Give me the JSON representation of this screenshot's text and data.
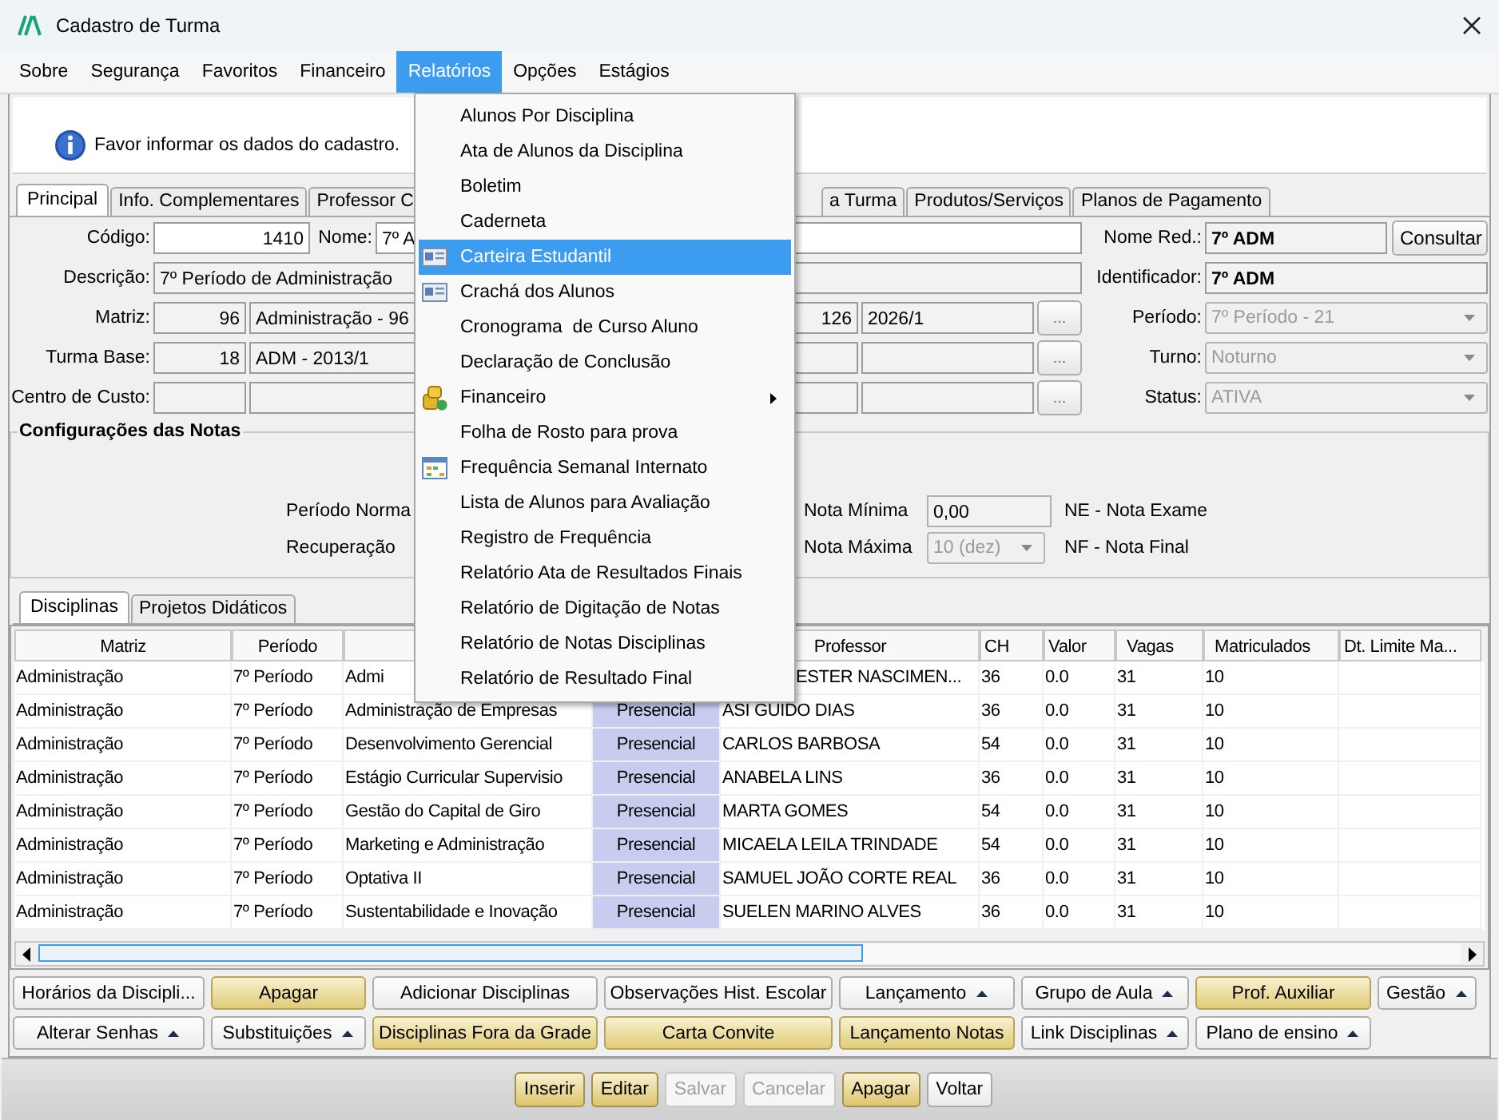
{
  "window": {
    "title": "Cadastro de Turma"
  },
  "menubar": [
    {
      "label": "Sobre",
      "selected": false
    },
    {
      "label": "Segurança",
      "selected": false
    },
    {
      "label": "Favoritos",
      "selected": false
    },
    {
      "label": "Financeiro",
      "selected": false
    },
    {
      "label": "Relatórios",
      "selected": true
    },
    {
      "label": "Opções",
      "selected": false
    },
    {
      "label": "Estágios",
      "selected": false
    }
  ],
  "menu": [
    {
      "label": "Alunos Por Disciplina",
      "selected": false,
      "kind": "plain"
    },
    {
      "label": "Ata de Alunos da Disciplina",
      "selected": false,
      "kind": "plain"
    },
    {
      "label": "Boletim",
      "selected": false,
      "kind": "plain"
    },
    {
      "label": "Caderneta",
      "selected": false,
      "kind": "plain"
    },
    {
      "label": "Carteira Estudantil",
      "selected": true,
      "kind": "card"
    },
    {
      "label": "Crachá dos Alunos",
      "selected": false,
      "kind": "card"
    },
    {
      "label": "Cronograma  de Curso Aluno",
      "selected": false,
      "kind": "plain"
    },
    {
      "label": "Declaração de Conclusão",
      "selected": false,
      "kind": "plain"
    },
    {
      "label": "Financeiro",
      "selected": false,
      "kind": "coins",
      "submenu": true
    },
    {
      "label": "Folha de Rosto para prova",
      "selected": false,
      "kind": "plain"
    },
    {
      "label": "Frequência Semanal Internato",
      "selected": false,
      "kind": "calendar"
    },
    {
      "label": "Lista de Alunos para Avaliação",
      "selected": false,
      "kind": "plain"
    },
    {
      "label": "Registro de Frequência",
      "selected": false,
      "kind": "plain"
    },
    {
      "label": "Relatório Ata de Resultados Finais",
      "selected": false,
      "kind": "plain"
    },
    {
      "label": "Relatório de Digitação de Notas",
      "selected": false,
      "kind": "plain"
    },
    {
      "label": "Relatório de Notas Disciplinas",
      "selected": false,
      "kind": "plain"
    },
    {
      "label": "Relatório de Resultado Final",
      "selected": false,
      "kind": "plain"
    }
  ],
  "info": "Favor informar os dados do cadastro.",
  "tabs": [
    {
      "label": "Principal",
      "selected": true
    },
    {
      "label": "Info. Complementares",
      "selected": false
    },
    {
      "label": "Professor C",
      "selected": false
    },
    {
      "label": "a Turma",
      "selected": false
    },
    {
      "label": "Produtos/Serviços",
      "selected": false
    },
    {
      "label": "Planos de Pagamento",
      "selected": false
    }
  ],
  "form": {
    "codigo": {
      "label": "Código:",
      "value": "1410"
    },
    "nome": {
      "label": "Nome:",
      "value": "7º A"
    },
    "nome_red": {
      "label": "Nome Red.:",
      "value": "7º ADM"
    },
    "consultar": "Consultar",
    "descricao": {
      "label": "Descrição:",
      "value": "7º Período de Administração"
    },
    "identificador": {
      "label": "Identificador:",
      "value": "7º ADM"
    },
    "matriz": {
      "label": "Matriz:",
      "code": "96",
      "name": "Administração - 96",
      "code_2": "126",
      "value_2": "2026/1",
      "browse": "..."
    },
    "turma_base": {
      "label": "Turma Base:",
      "code": "18",
      "name": "ADM - 2013/1",
      "browse": "..."
    },
    "centro_custo": {
      "label": "Centro de Custo:",
      "browse": "..."
    },
    "periodo": {
      "label": "Período:",
      "value": "7º Período - 21",
      "disabled": true
    },
    "turno": {
      "label": "Turno:",
      "value": "Noturno",
      "disabled": true
    },
    "status": {
      "label": "Status:",
      "value": "ATIVA",
      "disabled": true
    }
  },
  "notas": {
    "title": "Configurações das Notas",
    "periodo_normal": "Período Norma",
    "recuperacao": "Recuperação",
    "nota_minima": {
      "label": "Nota Mínima",
      "value": "0,00"
    },
    "nota_maxima": {
      "label": "Nota Máxima",
      "value": "10 (dez)",
      "disabled": true
    },
    "legend": [
      "NE - Nota Exame",
      "NF - Nota Final"
    ]
  },
  "lower_tabs": [
    {
      "label": "Disciplinas",
      "selected": true
    },
    {
      "label": "Projetos Didáticos",
      "selected": false
    }
  ],
  "table": {
    "columns": [
      "Matriz",
      "Período",
      null,
      null,
      "Professor",
      "CH",
      "Valor",
      "Vagas",
      "Matriculados",
      "Dt. Limite Ma..."
    ],
    "rows": [
      {
        "matriz": "Administração",
        "periodo": "7º Período",
        "column_3": "Admi",
        "professor": "ESTER NASCIMEN...",
        "professor_cut": true,
        "ch": "36",
        "valor": "0.0",
        "vagas": "31",
        "matriculados": "10"
      },
      {
        "matriz": "Administração",
        "periodo": "7º Período",
        "column_3": "Administração de Empresas",
        "column_4": "Presencial",
        "professor": "ASI GUIDO DIAS",
        "ch": "36",
        "valor": "0.0",
        "vagas": "31",
        "matriculados": "10"
      },
      {
        "matriz": "Administração",
        "periodo": "7º Período",
        "column_3": "Desenvolvimento Gerencial",
        "column_4": "Presencial",
        "professor": "CARLOS BARBOSA",
        "ch": "54",
        "valor": "0.0",
        "vagas": "31",
        "matriculados": "10"
      },
      {
        "matriz": "Administração",
        "periodo": "7º Período",
        "column_3": "Estágio Curricular Supervisio",
        "column_4": "Presencial",
        "professor": "ANABELA LINS",
        "ch": "36",
        "valor": "0.0",
        "vagas": "31",
        "matriculados": "10"
      },
      {
        "matriz": "Administração",
        "periodo": "7º Período",
        "column_3": "Gestão do Capital de Giro",
        "column_4": "Presencial",
        "professor": "MARTA GOMES",
        "ch": "54",
        "valor": "0.0",
        "vagas": "31",
        "matriculados": "10"
      },
      {
        "matriz": "Administração",
        "periodo": "7º Período",
        "column_3": "Marketing e Administração",
        "column_4": "Presencial",
        "professor": "MICAELA LEILA TRINDADE",
        "ch": "54",
        "valor": "0.0",
        "vagas": "31",
        "matriculados": "10"
      },
      {
        "matriz": "Administração",
        "periodo": "7º Período",
        "column_3": "Optativa II",
        "column_4": "Presencial",
        "professor": "SAMUEL JOÃO CORTE REAL",
        "ch": "36",
        "valor": "0.0",
        "vagas": "31",
        "matriculados": "10"
      },
      {
        "matriz": "Administração",
        "periodo": "7º Período",
        "column_3": "Sustentabilidade e Inovação",
        "column_4": "Presencial",
        "professor": "SUELEN MARINO ALVES",
        "ch": "36",
        "valor": "0.0",
        "vagas": "31",
        "matriculados": "10"
      }
    ]
  },
  "action_buttons": [
    [
      {
        "label": "Horários da Discipli...",
        "kind": "plain"
      },
      {
        "label": "Apagar",
        "kind": "highlight"
      },
      {
        "label": "Adicionar Disciplinas",
        "kind": "plain"
      },
      {
        "label": "Observações Hist. Escolar",
        "kind": "plain"
      },
      {
        "label": "Lançamento",
        "kind": "menu"
      },
      {
        "label": "Grupo de Aula",
        "kind": "menu"
      },
      {
        "label": "Prof. Auxiliar",
        "kind": "highlight"
      },
      {
        "label": "Gestão",
        "kind": "menu"
      }
    ],
    [
      {
        "label": "Alterar Senhas",
        "kind": "menu"
      },
      {
        "label": "Substituições",
        "kind": "menu"
      },
      {
        "label": "Disciplinas Fora da Grade",
        "kind": "highlight"
      },
      {
        "label": "Carta Convite",
        "kind": "highlight"
      },
      {
        "label": "Lançamento Notas",
        "kind": "highlight"
      },
      {
        "label": "Link Disciplinas",
        "kind": "menu"
      },
      {
        "label": "Plano de ensino",
        "kind": "menu"
      }
    ]
  ],
  "footer_buttons": [
    {
      "label": "Inserir",
      "kind": "highlight",
      "disabled": false
    },
    {
      "label": "Editar",
      "kind": "highlight",
      "disabled": false
    },
    {
      "label": "Salvar",
      "kind": "plain",
      "disabled": true
    },
    {
      "label": "Cancelar",
      "kind": "plain",
      "disabled": true
    },
    {
      "label": "Apagar",
      "kind": "highlight",
      "disabled": false
    },
    {
      "label": "Voltar",
      "kind": "plain",
      "disabled": false
    }
  ]
}
